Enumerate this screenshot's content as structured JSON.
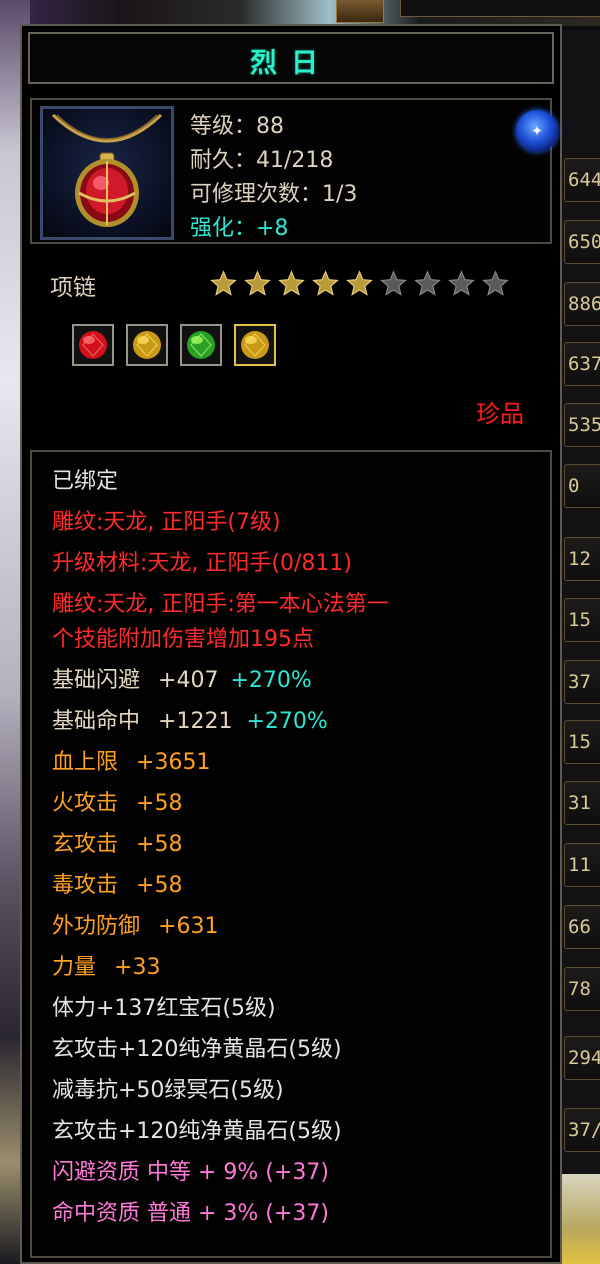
{
  "background": {
    "right_values": [
      "644",
      "650",
      "886",
      "637",
      "535",
      "0",
      "12",
      "15",
      "37",
      "15",
      "31",
      "11",
      "66",
      "78",
      "294",
      "37/"
    ]
  },
  "tooltip": {
    "title": "烈日",
    "level_line": "等级：88",
    "durability_line": "耐久：41/218",
    "repair_line": "可修理次数：1/3",
    "enhance_line": "强化：+8",
    "badge_icon": "mystic-orb-icon",
    "category": "项链",
    "stars": {
      "filled": 5,
      "total": 9
    },
    "gems": [
      "ruby-gem-icon",
      "yellow-crystal-gem-icon",
      "green-gem-icon",
      "yellow-crystal-gem-icon"
    ],
    "rarity": "珍品",
    "details": {
      "bound": "已绑定",
      "engrave1": "雕纹:天龙, 正阳手(7级)",
      "upgrade": "升级材料:天龙, 正阳手(0/811)",
      "engrave2_line1": "雕纹:天龙, 正阳手:第一本心法第一",
      "engrave2_line2": "个技能附加伤害增加195点",
      "dodge_label": "基础闪避",
      "dodge_value": "+407",
      "dodge_pct": "+270%",
      "hit_label": "基础命中",
      "hit_value": "+1221",
      "hit_pct": "+270%",
      "hp_label": "血上限",
      "hp_value": "+3651",
      "fire_label": "火攻击",
      "fire_value": "+58",
      "xuan_label": "玄攻击",
      "xuan_value": "+58",
      "poison_label": "毒攻击",
      "poison_value": "+58",
      "def_label": "外功防御",
      "def_value": "+631",
      "str_label": "力量",
      "str_value": "+33",
      "gem_line1": "体力+137红宝石(5级)",
      "gem_line2": "玄攻击+120纯净黄晶石(5级)",
      "gem_line3": "减毒抗+50绿冥石(5级)",
      "gem_line4": "玄攻击+120纯净黄晶石(5级)",
      "apt1": "闪避资质 中等 + 9% (+37)",
      "apt2": "命中资质 普通 + 3% (+37)"
    }
  },
  "colors": {
    "title": "#2ef0c8",
    "engrave": "#ff2a2a",
    "bonus": "#ffa020",
    "aptitude": "#ff7ad6",
    "percent": "#2ee6d4"
  }
}
